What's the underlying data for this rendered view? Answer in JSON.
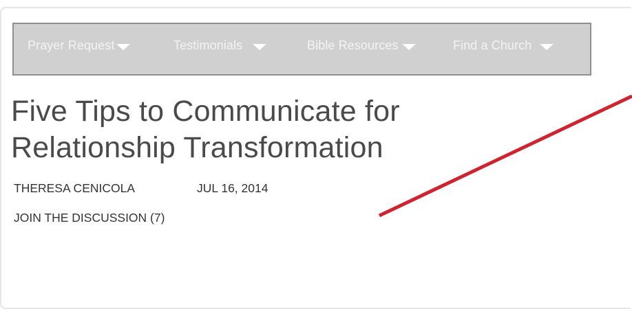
{
  "nav": {
    "items": [
      {
        "label": "Prayer Request"
      },
      {
        "label": "Testimonials"
      },
      {
        "label": "Bible Resources"
      },
      {
        "label": "Find a Church"
      }
    ]
  },
  "article": {
    "title_line1": "Five Tips to Communicate for",
    "title_line2": "Relationship Transformation",
    "author": "THERESA CENICOLA",
    "date": "JUL 16, 2014",
    "discussion_link": "JOIN THE DISCUSSION (7)"
  },
  "colors": {
    "nav_background": "#d0d0d0",
    "nav_text": "#f4f4f4",
    "annotation_line": "#d0232f"
  },
  "icons": [
    "chevron-down-icon"
  ]
}
